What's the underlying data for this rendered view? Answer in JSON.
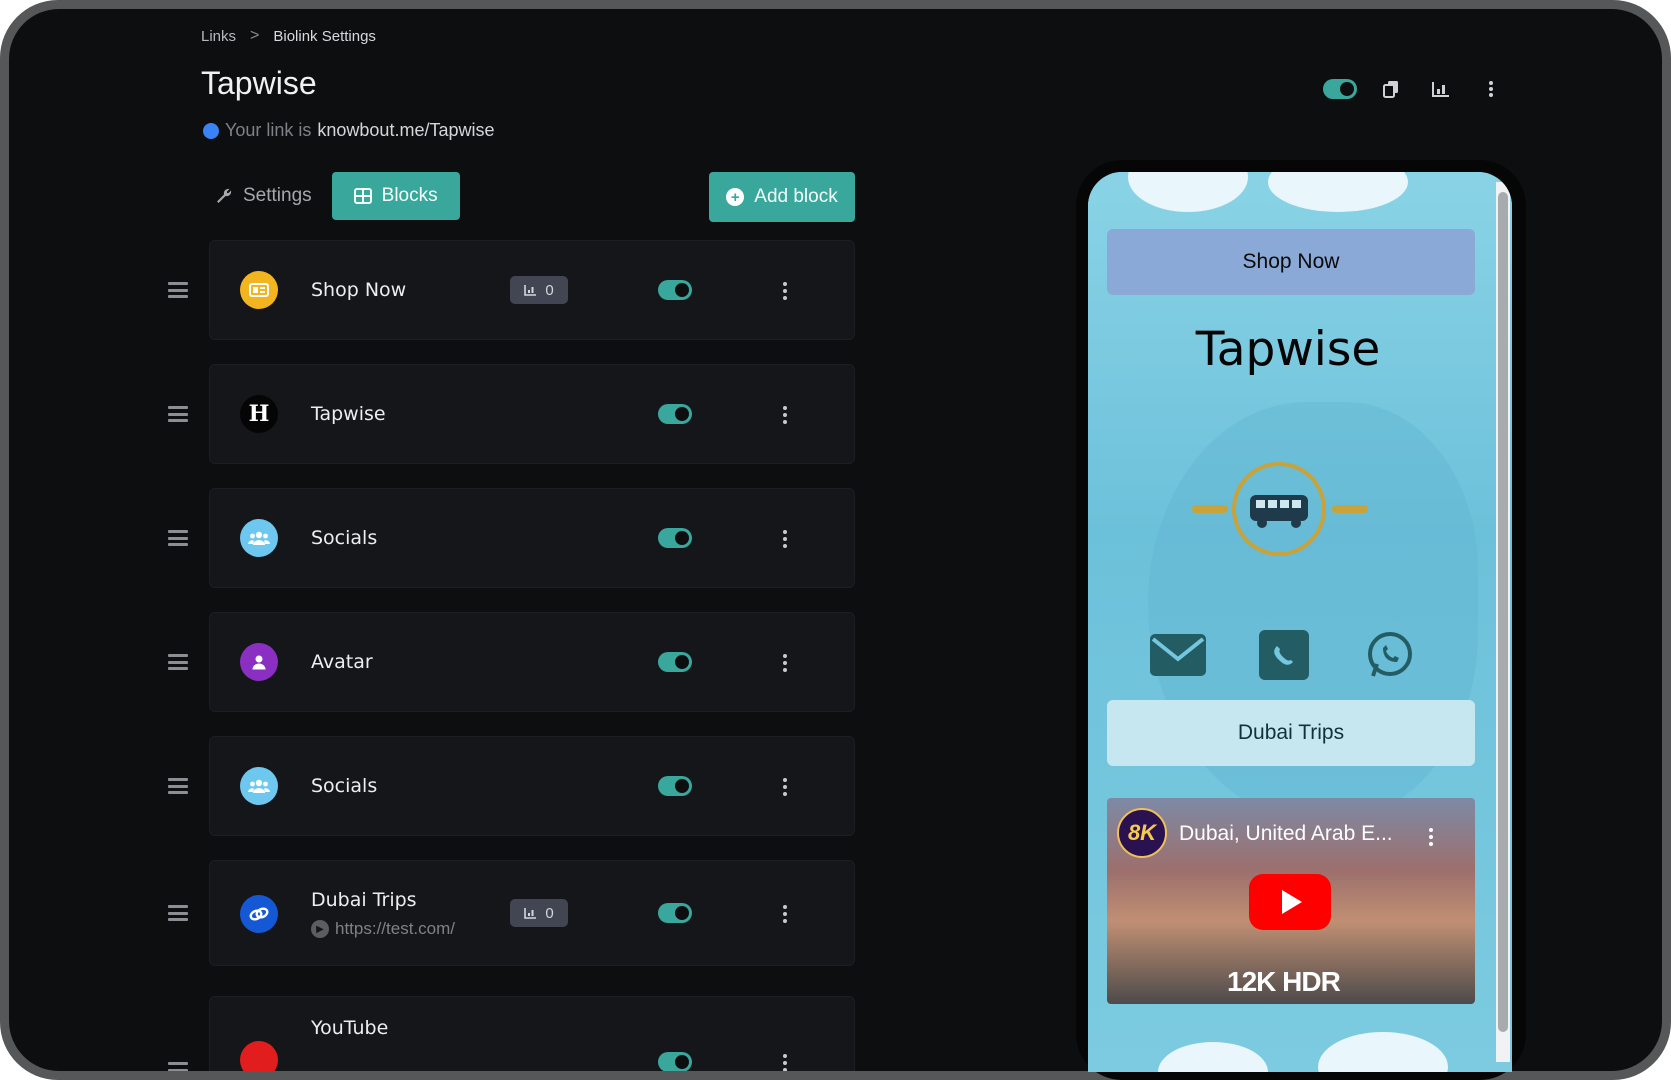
{
  "breadcrumb": {
    "links": "Links",
    "separator": ">",
    "current": "Biolink Settings"
  },
  "page": {
    "title": "Tapwise",
    "link_prefix": "Your link is",
    "link_url": "knowbout.me/Tapwise"
  },
  "header_actions": {
    "enabled": true,
    "icons": [
      "copy-icon",
      "stats-icon",
      "more-vertical-icon"
    ]
  },
  "tabs": {
    "settings": "Settings",
    "blocks": "Blocks",
    "active": "Blocks"
  },
  "add_block_label": "Add block",
  "colors": {
    "accent": "#3aa79d",
    "bg": "#0d0e10",
    "card": "#15161a"
  },
  "blocks": [
    {
      "name": "Shop Now",
      "icon": "card-icon",
      "icon_color": "#f2b51f",
      "clicks": "0",
      "enabled": true
    },
    {
      "name": "Tapwise",
      "icon": "heading-icon",
      "icon_char": "H",
      "icon_color": "#050505",
      "enabled": true
    },
    {
      "name": "Socials",
      "icon": "users-icon",
      "icon_color": "#6dc7ee",
      "enabled": true
    },
    {
      "name": "Avatar",
      "icon": "user-icon",
      "icon_color": "#8a2fc1",
      "enabled": true
    },
    {
      "name": "Socials",
      "icon": "users-icon",
      "icon_color": "#6dc7ee",
      "enabled": true
    },
    {
      "name": "Dubai Trips",
      "url": "https://test.com/",
      "icon": "link-icon",
      "icon_color": "#1558d6",
      "clicks": "0",
      "enabled": true
    },
    {
      "name": "YouTube",
      "icon": "youtube-icon",
      "icon_color": "#e11d1d",
      "enabled": true
    }
  ],
  "preview": {
    "shop_now": "Shop Now",
    "title": "Tapwise",
    "link_button": "Dubai Trips",
    "video_title": "Dubai, United Arab E...",
    "video_channel": "8K",
    "video_badge": "12K HDR",
    "social_icons": [
      "mail-icon",
      "phone-icon",
      "whatsapp-icon"
    ]
  }
}
